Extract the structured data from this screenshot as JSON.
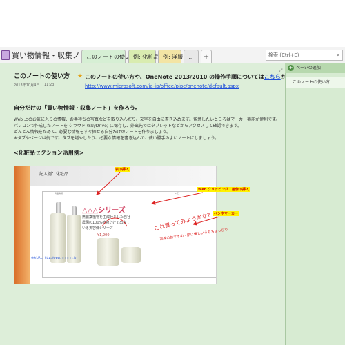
{
  "notebook": {
    "title": "買い物情報・収集ノート"
  },
  "tabs": [
    {
      "label": "このノートの使い方"
    },
    {
      "label": "例: 化粧品"
    },
    {
      "label": "例: 洋服"
    },
    {
      "label": "..."
    },
    {
      "label": "+"
    }
  ],
  "search": {
    "placeholder": "検索 (Ctrl+E)"
  },
  "page": {
    "title": "このノートの使い方",
    "date": "2013年10月4日",
    "time": "11:23",
    "intro_text": "このノートの使い方や、OneNote 2013/2010 の操作手順については",
    "intro_link": "こちら",
    "intro_suffix": "から",
    "intro_url": "http://www.microsoft.com/ja-jp/office/pipc/onenote/default.aspx",
    "heading_own": "自分だけの「買い物情報・収集ノート」を作ろう。",
    "body_lines": [
      "Web 上のお気に入りの情報、お手持ちの写真などを取り込んだり、文字を自由に書き込めます。留意したいところはマーカー機能が便利です。",
      "パソコンで作成したノートを クラウド (SkyDrive) に保存し、外出先ではタブレットなどからアクセスして確認できます。",
      "どんどん情報をためて、必要な情報をすぐ探せる自分だけのノートを作りましょう。",
      "※タブやページは例です。タブを増やしたり、必要な情報を書き込んで、使い勝手のよいノートにしましょう。"
    ],
    "heading_example": "<化粧品セクション活用例>"
  },
  "example": {
    "label": "記入例：化粧品",
    "label2": "",
    "col_head_left": "商品情報",
    "col_head_right": "メモ",
    "series_title": "△△△シリーズ",
    "series_lines": [
      "無農薬植物を主成分とした自社",
      "農園の100%植物だけで出来て",
      "いる美容体シリーズ"
    ],
    "price": "¥1,200",
    "footer": "参考URL：http://www.○○○○○.jp"
  },
  "annotations": {
    "table_insert": "表の挿入",
    "web_clip": "Web クリッピング・画像の挿入",
    "pen_marker": "ペンやマーカー",
    "handwriting_1": "これ買ってみようかな?",
    "handwriting_2": "友達のおすすめ・肌に優しいうちちょっぴり"
  },
  "right_pane": {
    "add_page": "ページの追加",
    "pages": [
      "このノートの使い方"
    ]
  },
  "colors": {
    "canvas": "#ddeed9",
    "pane": "#d7ebd2",
    "link": "#1f4fd8",
    "highlight": "#fff200",
    "annotation": "#cc0000"
  }
}
